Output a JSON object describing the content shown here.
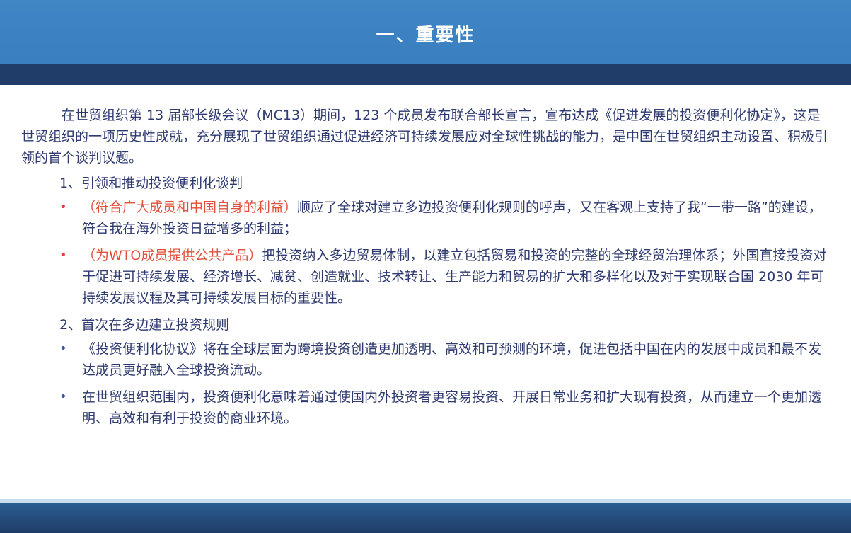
{
  "slide": {
    "title": "一、重要性",
    "intro": "在世贸组织第 13 届部长级会议（MC13）期间，123 个成员发布联合部长宣言，宣布达成《促进发展的投资便利化协定》，这是世贸组织的一项历史性成就，充分展现了世贸组织通过促进经济可持续发展应对全球性挑战的能力，是中国在世贸组织主动设置、积极引领的首个谈判议题。",
    "section1": {
      "heading": "1、引领和推动投资便利化谈判",
      "items": [
        {
          "bullet": "•",
          "highlight": "（符合广大成员和中国自身的利益）",
          "text": "顺应了全球对建立多边投资便利化规则的呼声，又在客观上支持了我“一带一路”的建设，符合我在海外投资日益增多的利益；"
        },
        {
          "bullet": "•",
          "highlight": "（为WTO成员提供公共产品）",
          "text": "把投资纳入多边贸易体制，以建立包括贸易和投资的完整的全球经贸治理体系；外国直接投资对于促进可持续发展、经济增长、减贫、创造就业、技术转让、生产能力和贸易的扩大和多样化以及对于实现联合国 2030 年可持续发展议程及其可持续发展目标的重要性。"
        }
      ]
    },
    "section2": {
      "heading": "2、首次在多边建立投资规则",
      "items": [
        {
          "bullet": "•",
          "text": "《投资便利化协议》将在全球层面为跨境投资创造更加透明、高效和可预测的环境，促进包括中国在内的发展中成员和最不发达成员更好融入全球投资流动。"
        },
        {
          "bullet": "•",
          "text": "在世贸组织范围内，投资便利化意味着通过使国内外投资者更容易投资、开展日常业务和扩大现有投资，从而建立一个更加透明、高效和有利于投资的商业环境。"
        }
      ]
    }
  },
  "colors": {
    "header_blue": "#3f86c5",
    "header_dark": "#1f3d68",
    "body_text": "#2e3a70",
    "highlight_red": "#e0503a"
  }
}
